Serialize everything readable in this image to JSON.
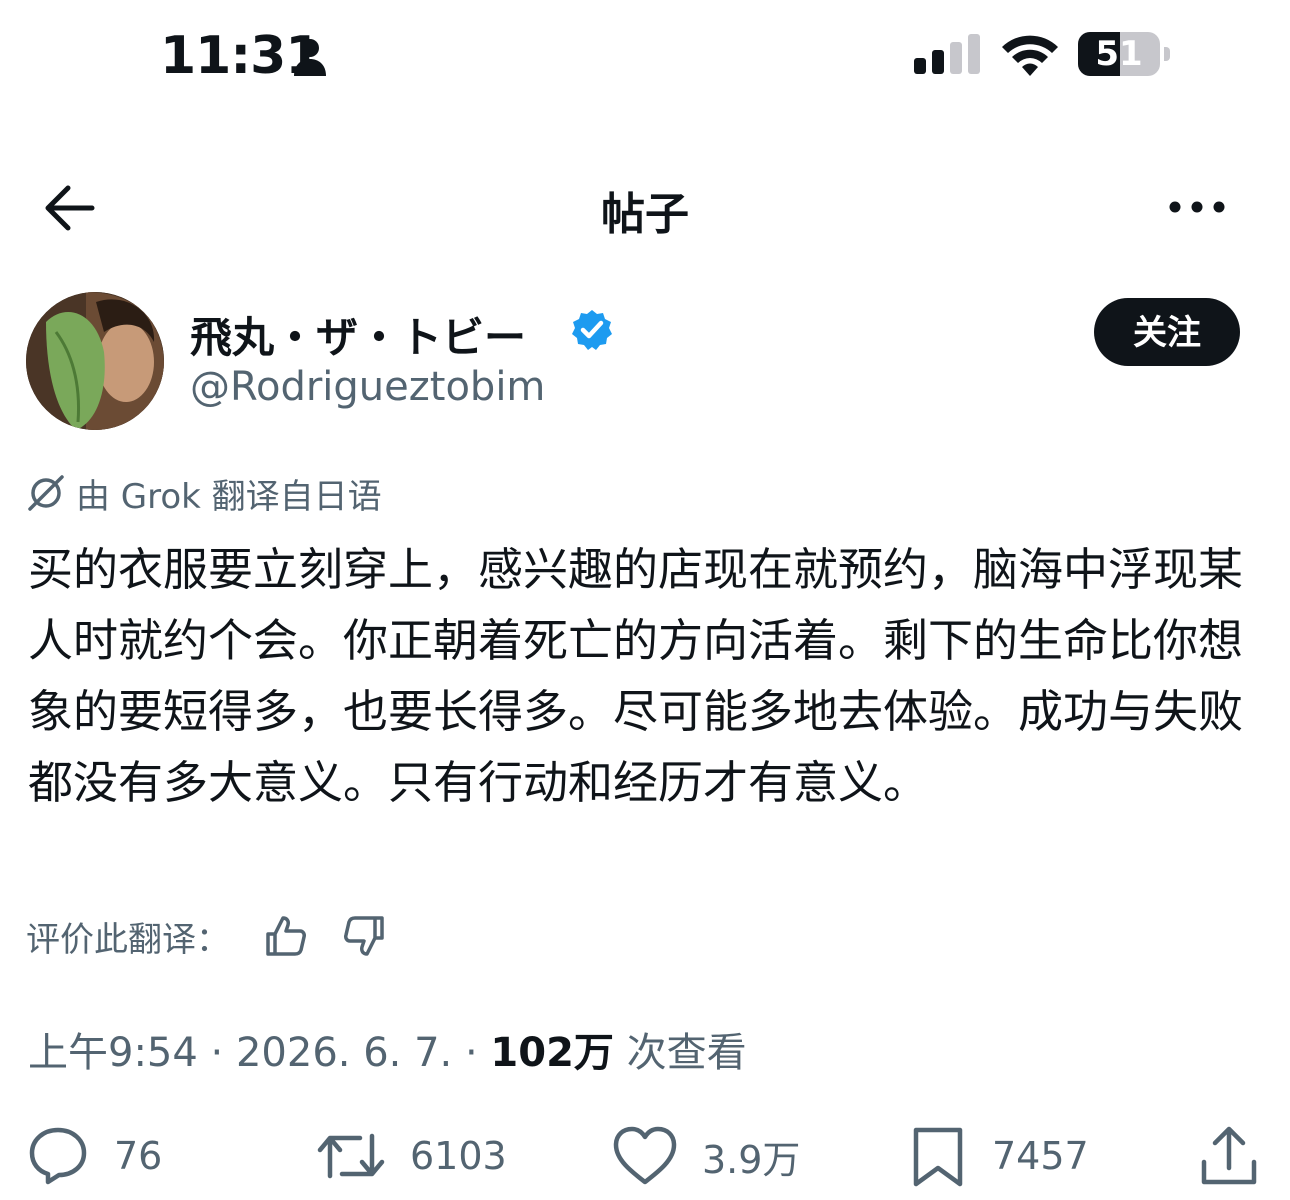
{
  "status_bar": {
    "time": "11:31",
    "battery_level": "51",
    "battery_fraction": 0.51,
    "icons": [
      "person-icon",
      "signal-icon",
      "wifi-icon",
      "battery-icon"
    ]
  },
  "nav": {
    "title": "帖子",
    "icons": [
      "back-arrow-icon",
      "more-icon"
    ]
  },
  "author": {
    "name": "飛丸・ザ・トビー",
    "handle": "@Rodrigueztobim",
    "verified": true,
    "follow_label": "关注"
  },
  "translation": {
    "note": "由 Grok 翻译自日语",
    "rate_label": "评价此翻译："
  },
  "post": {
    "text": "买的衣服要立刻穿上，感兴趣的店现在就预约，脑海中浮现某人时就约个会。你正朝着死亡的方向活着。剩下的生命比你想象的要短得多，也要长得多。尽可能多地去体验。成功与失败都没有多大意义。只有行动和经历才有意义。"
  },
  "meta": {
    "time": "上午9:54",
    "separator": "·",
    "date": "2026. 6. 7.",
    "views": "102万",
    "views_label": "次查看"
  },
  "actions": {
    "replies": "76",
    "reposts": "6103",
    "likes": "3.9万",
    "bookmarks": "7457"
  },
  "colors": {
    "text": "#0f1419",
    "secondary": "#536471",
    "verified": "#1d9bf0"
  }
}
